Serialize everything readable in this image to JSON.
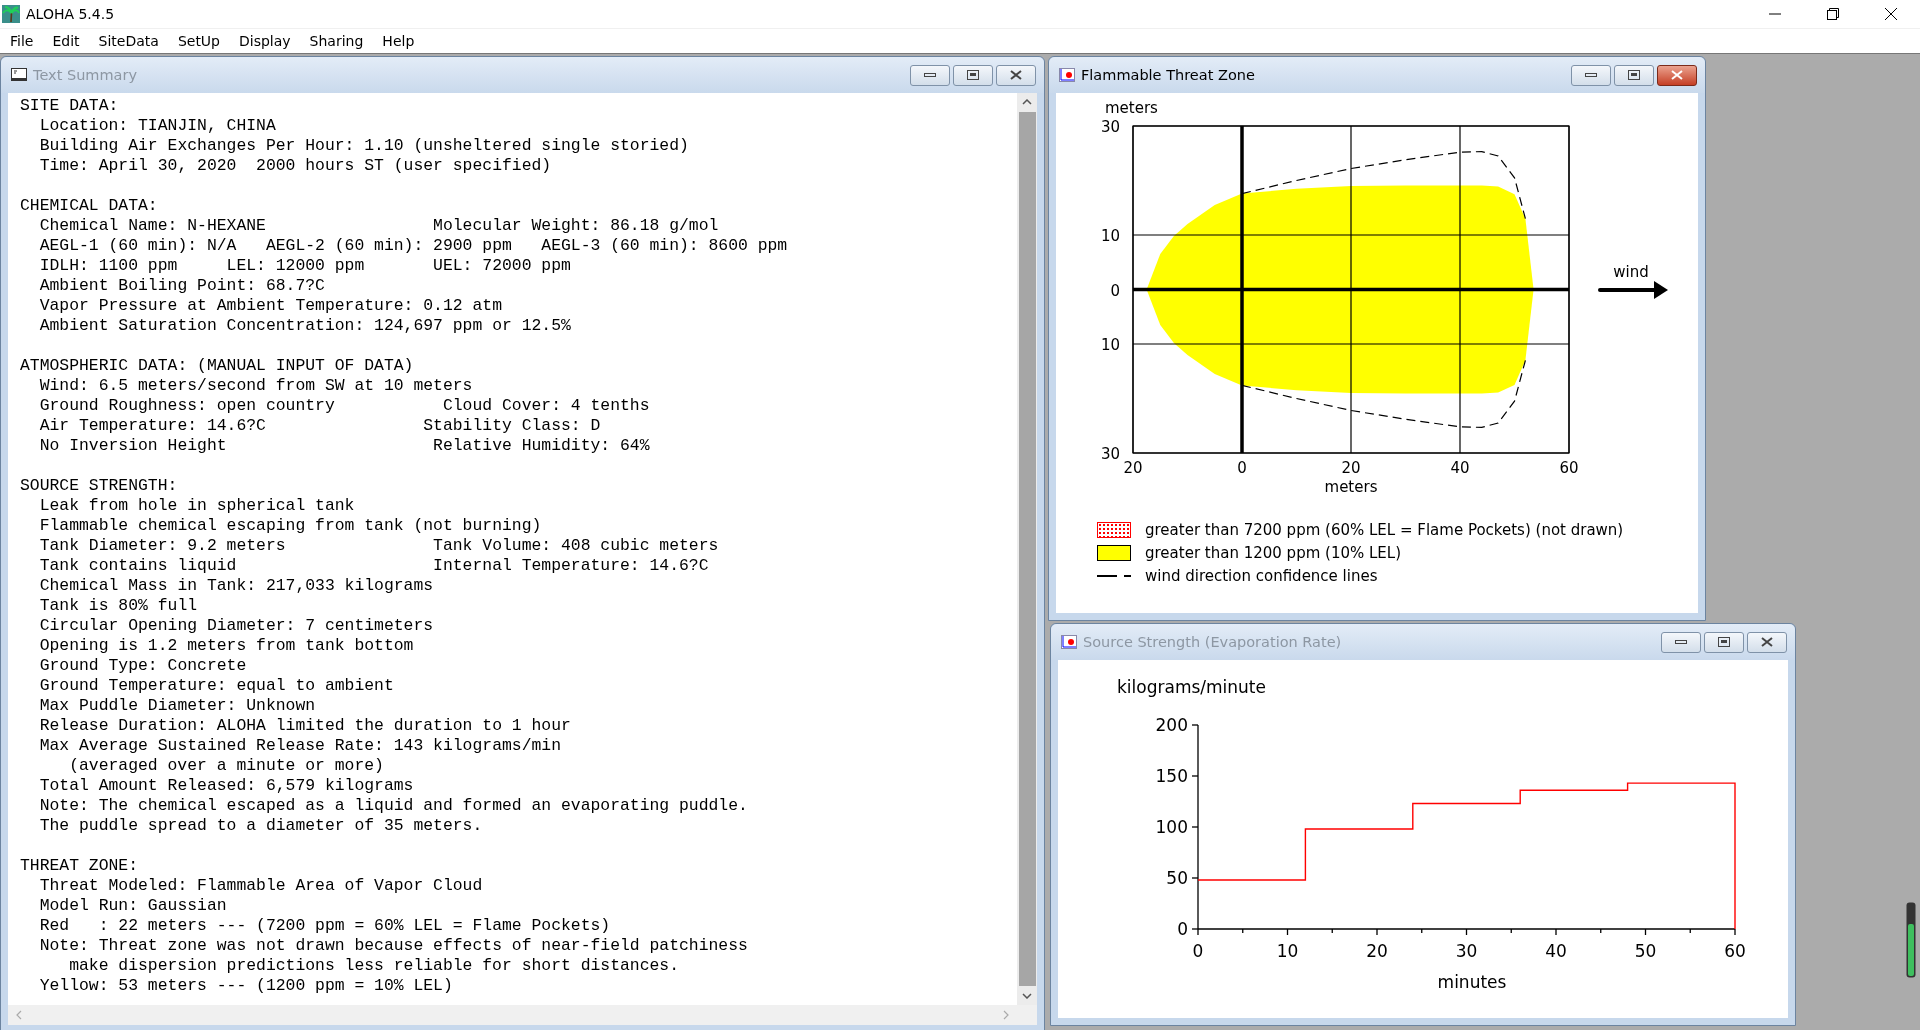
{
  "app": {
    "title": "ALOHA 5.4.5"
  },
  "menu": [
    "File",
    "Edit",
    "SiteData",
    "SetUp",
    "Display",
    "Sharing",
    "Help"
  ],
  "text_summary": {
    "title": "Text Summary",
    "active": false,
    "sections": [
      {
        "heading": "SITE DATA:",
        "lines": [
          {
            "kind": "line",
            "text": "Location: TIANJIN, CHINA"
          },
          {
            "kind": "line",
            "text": "Building Air Exchanges Per Hour: 1.10 (unsheltered single storied)"
          },
          {
            "kind": "line",
            "text": "Time: April 30, 2020  2000 hours ST (user specified)"
          }
        ]
      },
      {
        "heading": "CHEMICAL DATA:",
        "lines": [
          {
            "kind": "line",
            "text": "Chemical Name: N-HEXANE                 Molecular Weight: 86.18 g/mol"
          },
          {
            "kind": "line",
            "text": "AEGL-1 (60 min): N/A   AEGL-2 (60 min): 2900 ppm   AEGL-3 (60 min): 8600 ppm"
          },
          {
            "kind": "line",
            "text": "IDLH: 1100 ppm     LEL: 12000 ppm       UEL: 72000 ppm"
          },
          {
            "kind": "line",
            "text": "Ambient Boiling Point: 68.7?C"
          },
          {
            "kind": "line",
            "text": "Vapor Pressure at Ambient Temperature: 0.12 atm"
          },
          {
            "kind": "line",
            "text": "Ambient Saturation Concentration: 124,697 ppm or 12.5%"
          }
        ]
      },
      {
        "heading": "ATMOSPHERIC DATA: (MANUAL INPUT OF DATA)",
        "lines": [
          {
            "kind": "line",
            "text": "Wind: 6.5 meters/second from SW at 10 meters"
          },
          {
            "kind": "line",
            "text": "Ground Roughness: open country           Cloud Cover: 4 tenths"
          },
          {
            "kind": "line",
            "text": "Air Temperature: 14.6?C                Stability Class: D"
          },
          {
            "kind": "line",
            "text": "No Inversion Height                     Relative Humidity: 64%"
          }
        ]
      },
      {
        "heading": "SOURCE STRENGTH:",
        "lines": [
          {
            "kind": "line",
            "text": "Leak from hole in spherical tank"
          },
          {
            "kind": "line",
            "text": "Flammable chemical escaping from tank (not burning)"
          },
          {
            "kind": "line",
            "text": "Tank Diameter: 9.2 meters               Tank Volume: 408 cubic meters"
          },
          {
            "kind": "line",
            "text": "Tank contains liquid                    Internal Temperature: 14.6?C"
          },
          {
            "kind": "line",
            "text": "Chemical Mass in Tank: 217,033 kilograms"
          },
          {
            "kind": "line",
            "text": "Tank is 80% full"
          },
          {
            "kind": "line",
            "text": "Circular Opening Diameter: 7 centimeters"
          },
          {
            "kind": "line",
            "text": "Opening is 1.2 meters from tank bottom"
          },
          {
            "kind": "line",
            "text": "Ground Type: Concrete"
          },
          {
            "kind": "line",
            "text": "Ground Temperature: equal to ambient"
          },
          {
            "kind": "line",
            "text": "Max Puddle Diameter: Unknown"
          },
          {
            "kind": "line",
            "text": "Release Duration: ALOHA limited the duration to 1 hour"
          },
          {
            "kind": "line",
            "text": "Max Average Sustained Release Rate: 143 kilograms/min"
          },
          {
            "kind": "wrap",
            "text": "(averaged over a minute or more)"
          },
          {
            "kind": "line",
            "text": "Total Amount Released: 6,579 kilograms"
          },
          {
            "kind": "line",
            "text": "Note: The chemical escaped as a liquid and formed an evaporating puddle."
          },
          {
            "kind": "line",
            "text": "The puddle spread to a diameter of 35 meters."
          }
        ]
      },
      {
        "heading": "THREAT ZONE:",
        "lines": [
          {
            "kind": "line",
            "text": "Threat Modeled: Flammable Area of Vapor Cloud"
          },
          {
            "kind": "line",
            "text": "Model Run: Gaussian"
          },
          {
            "kind": "line",
            "text": "Red   : 22 meters --- (7200 ppm = 60% LEL = Flame Pockets)"
          },
          {
            "kind": "line",
            "text": "Note: Threat zone was not drawn because effects of near-field patchiness"
          },
          {
            "kind": "wrap",
            "text": "make dispersion predictions less reliable for short distances."
          },
          {
            "kind": "line",
            "text": "Yellow: 53 meters --- (1200 ppm = 10% LEL)"
          }
        ]
      }
    ]
  },
  "threat_zone": {
    "title": "Flammable Threat Zone",
    "active": true,
    "wind_label": "wind",
    "chart_data": {
      "type": "area",
      "xlabel": "meters",
      "ylabel": "meters",
      "x": [
        -17.5,
        -15,
        -12.5,
        -10,
        -5,
        0,
        10,
        20,
        30,
        40,
        44,
        47,
        50,
        52,
        53.5
      ],
      "series": [
        {
          "color": "#ffff00",
          "values": [
            0,
            6.5,
            9.8,
            12,
            15.5,
            17.6,
            18.5,
            19,
            19.1,
            19.1,
            19.1,
            18.9,
            17.5,
            13,
            0
          ]
        },
        {
          "color": "#ffff00",
          "values": [
            0,
            -6.5,
            -9.8,
            -12,
            -15.5,
            -17.6,
            -18.5,
            -19,
            -19.1,
            -19.1,
            -19.1,
            -18.9,
            -17.5,
            -13,
            0
          ]
        },
        {
          "type": "line",
          "line_style": "dashed",
          "color": "#000000",
          "values": [
            null,
            null,
            null,
            null,
            null,
            17.6,
            20,
            22.2,
            23.8,
            25.2,
            25.3,
            24.5,
            20.5,
            13,
            null
          ]
        },
        {
          "type": "line",
          "line_style": "dashed",
          "color": "#000000",
          "values": [
            null,
            null,
            null,
            null,
            null,
            -17.6,
            -20,
            -22.2,
            -23.8,
            -25.2,
            -25.3,
            -24.5,
            -20.5,
            -13,
            null
          ]
        }
      ],
      "grid": true,
      "xlim": [
        -20,
        60
      ],
      "ylim": [
        -30,
        30
      ],
      "xticks": [
        {
          "value": -20,
          "label": "20"
        },
        0,
        20,
        40,
        60
      ],
      "yticks": [
        {
          "value": -30,
          "label": "30"
        },
        {
          "value": -10,
          "label": "10"
        },
        0,
        10,
        30
      ]
    },
    "legend": [
      {
        "kind": "dotted",
        "color": "#ff0000",
        "label": "greater than 7200 ppm (60% LEL = Flame Pockets) (not drawn)"
      },
      {
        "kind": "filled",
        "color": "#ffff00",
        "label": "greater than 1200 ppm (10% LEL)"
      },
      {
        "kind": "dashed",
        "color": "#000000",
        "label": "wind direction confidence lines"
      }
    ]
  },
  "source_strength": {
    "title": "Source Strength (Evaporation Rate)",
    "active": false,
    "chart_data": {
      "type": "line",
      "xlabel": "minutes",
      "ylabel": "kilograms/minute",
      "x": [
        0,
        12,
        12,
        24,
        24,
        36,
        36,
        48,
        48,
        60,
        60
      ],
      "series": [
        {
          "color": "#ff0000",
          "values": [
            48,
            48,
            98,
            98,
            123,
            123,
            136,
            136,
            143,
            143,
            0
          ]
        }
      ],
      "xlim": [
        0,
        60
      ],
      "ylim": [
        0,
        200
      ],
      "xticks": [
        0,
        10,
        20,
        30,
        40,
        50,
        60
      ],
      "yticks": [
        0,
        50,
        100,
        150,
        200
      ]
    }
  }
}
